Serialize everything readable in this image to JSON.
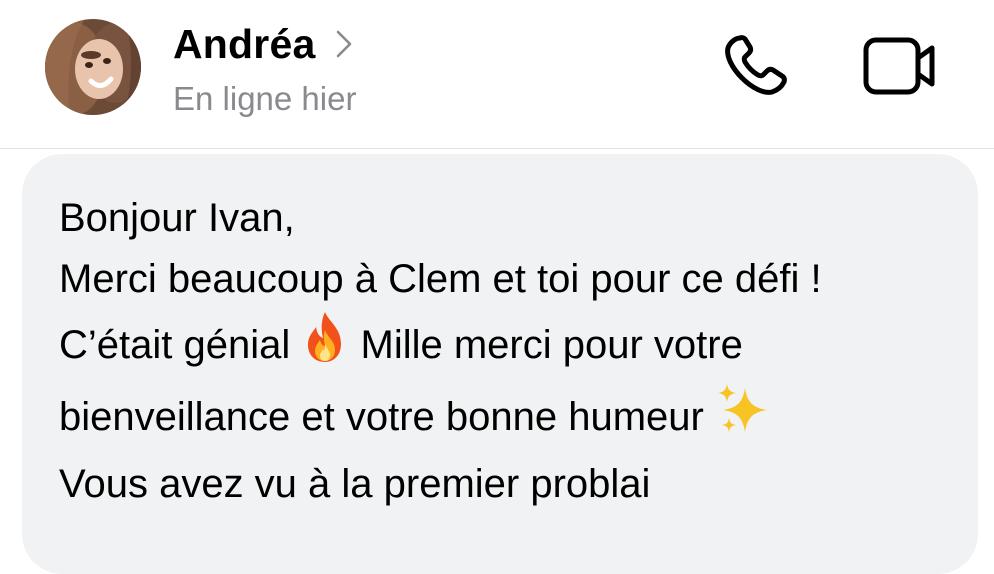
{
  "header": {
    "contact_name": "Andréa",
    "status": "En ligne hier",
    "icons": {
      "avatar": "profile-photo",
      "chevron": "chevron-right-icon",
      "call": "phone-icon",
      "video": "video-camera-icon"
    }
  },
  "message": {
    "greeting": "Bonjour Ivan,",
    "part1": "Merci beaucoup à Clem et toi pour ce défi ! C’était génial",
    "emoji1": "🔥",
    "part2": "Mille merci pour votre bienveillance et votre bonne humeur",
    "emoji2": "✨",
    "part3": "Vous avez vu à la premier problai"
  },
  "colors": {
    "bubble_background": "#f0f2f3",
    "status_text": "#8a8a8e",
    "divider": "#e2e2e4"
  }
}
